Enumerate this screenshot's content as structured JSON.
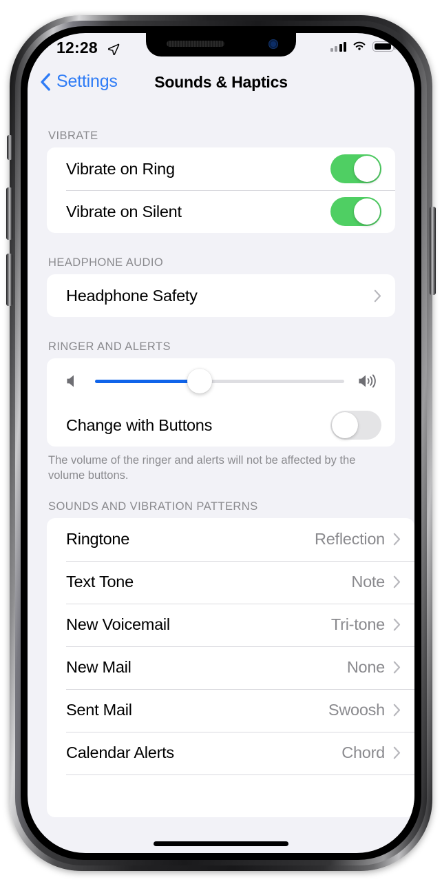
{
  "status_bar": {
    "time": "12:28",
    "location_icon": "location-arrow-icon",
    "signal_icon": "cellular-bars-icon",
    "wifi_icon": "wifi-icon",
    "battery_icon": "battery-full-icon"
  },
  "nav": {
    "back_label": "Settings",
    "back_icon": "chevron-left-icon",
    "title": "Sounds & Haptics"
  },
  "sections": [
    {
      "header": "VIBRATE",
      "rows": [
        {
          "label": "Vibrate on Ring",
          "control": "toggle",
          "state": "on"
        },
        {
          "label": "Vibrate on Silent",
          "control": "toggle",
          "state": "on"
        }
      ]
    },
    {
      "header": "HEADPHONE AUDIO",
      "rows": [
        {
          "label": "Headphone Safety",
          "control": "disclosure",
          "value": ""
        }
      ]
    },
    {
      "header": "RINGER AND ALERTS",
      "footer": "The volume of the ringer and alerts will not be affected by the volume buttons.",
      "slider": {
        "left_icon": "speaker-low-icon",
        "right_icon": "speaker-high-icon",
        "value_percent": 42
      },
      "rows": [
        {
          "label": "Change with Buttons",
          "control": "toggle",
          "state": "off"
        }
      ]
    },
    {
      "header": "SOUNDS AND VIBRATION PATTERNS",
      "rows": [
        {
          "label": "Ringtone",
          "control": "disclosure",
          "value": "Reflection"
        },
        {
          "label": "Text Tone",
          "control": "disclosure",
          "value": "Note"
        },
        {
          "label": "New Voicemail",
          "control": "disclosure",
          "value": "Tri-tone"
        },
        {
          "label": "New Mail",
          "control": "disclosure",
          "value": "None"
        },
        {
          "label": "Sent Mail",
          "control": "disclosure",
          "value": "Swoosh"
        },
        {
          "label": "Calendar Alerts",
          "control": "disclosure",
          "value": "Chord"
        }
      ]
    }
  ],
  "colors": {
    "accent_blue": "#2f7cf6",
    "slider_blue": "#1064ea",
    "toggle_on_green": "#4fcf63",
    "toggle_off_gray": "#e4e4e6",
    "background": "#f2f2f7",
    "card": "#ffffff",
    "secondary_text": "#8a8a8e"
  }
}
